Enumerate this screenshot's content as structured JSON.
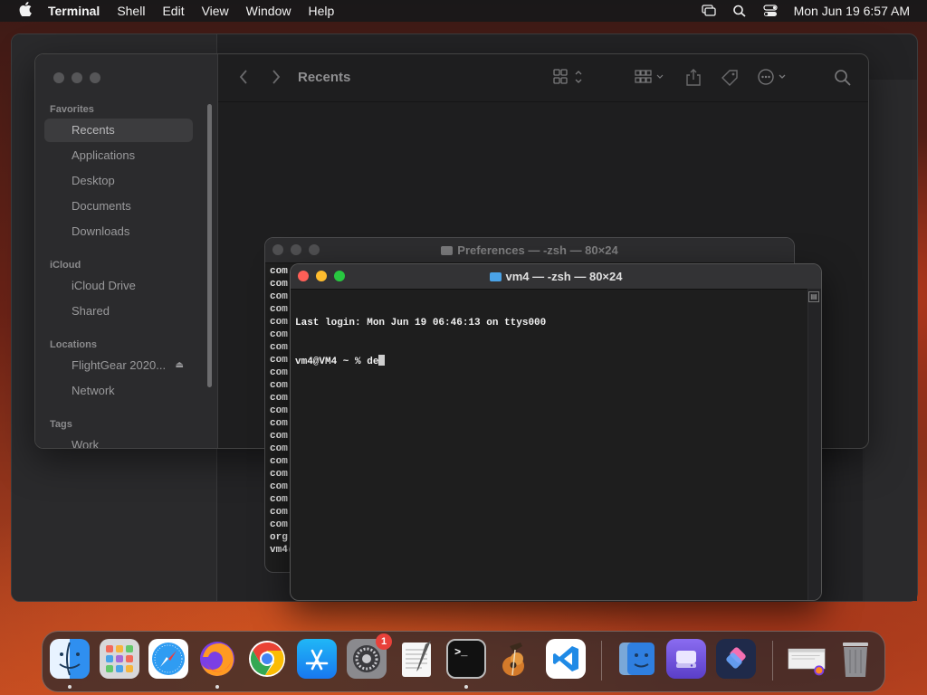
{
  "menubar": {
    "apple_icon": "apple-logo-icon",
    "app_name": "Terminal",
    "menus": [
      "Shell",
      "Edit",
      "View",
      "Window",
      "Help"
    ],
    "status_icons": [
      "screen-mirroring-icon",
      "spotlight-search-icon",
      "control-center-icon"
    ],
    "clock": "Mon Jun 19  6:57 AM"
  },
  "finder": {
    "title": "Recents",
    "sections": {
      "favorites": "Favorites",
      "icloud": "iCloud",
      "locations": "Locations",
      "tags": "Tags"
    },
    "favorites": [
      "Recents",
      "Applications",
      "Desktop",
      "Documents",
      "Downloads"
    ],
    "icloud_items": [
      "iCloud Drive",
      "Shared"
    ],
    "locations": [
      "FlightGear 2020...",
      "Network"
    ],
    "tags": [
      "Work"
    ],
    "selected": "Recents"
  },
  "terminal_back": {
    "title": "Preferences — -zsh — 80×24",
    "visible_lines": [
      "com",
      "com",
      "com",
      "com",
      "com",
      "com",
      "com",
      "com",
      "com",
      "com",
      "com",
      "com",
      "com",
      "com",
      "com",
      "com",
      "com",
      "com",
      "com",
      "com",
      "com",
      "org",
      "vm4("
    ]
  },
  "terminal_front": {
    "title": "vm4 — -zsh — 80×24",
    "lines": [
      "Last login: Mon Jun 19 06:46:13 on ttys000",
      "vm4@VM4 ~ % de"
    ]
  },
  "dock": {
    "apps": [
      {
        "name": "Finder",
        "icon": "finder-icon",
        "running": true
      },
      {
        "name": "Launchpad",
        "icon": "launchpad-icon",
        "running": false
      },
      {
        "name": "Safari",
        "icon": "safari-icon",
        "running": false
      },
      {
        "name": "Firefox",
        "icon": "firefox-icon",
        "running": true
      },
      {
        "name": "Chrome",
        "icon": "chrome-icon",
        "running": false
      },
      {
        "name": "App Store",
        "icon": "app-store-icon",
        "running": false
      },
      {
        "name": "System Settings",
        "icon": "system-settings-icon",
        "running": false,
        "badge": "1"
      },
      {
        "name": "TextEdit",
        "icon": "textedit-icon",
        "running": false
      },
      {
        "name": "Terminal",
        "icon": "terminal-icon",
        "running": true
      },
      {
        "name": "GarageBand",
        "icon": "garageband-icon",
        "running": false
      },
      {
        "name": "Visual Studio Code",
        "icon": "vscode-icon",
        "running": false
      },
      {
        "name": "Migration Assistant",
        "icon": "migration-assistant-icon",
        "running": false
      },
      {
        "name": "Disk Utility",
        "icon": "disk-utility-icon",
        "running": false
      },
      {
        "name": "Shortcuts",
        "icon": "shortcuts-icon",
        "running": false
      },
      {
        "name": "Downloads Stack",
        "icon": "downloads-stack-icon",
        "running": false
      },
      {
        "name": "Trash",
        "icon": "trash-icon",
        "running": false
      }
    ]
  }
}
